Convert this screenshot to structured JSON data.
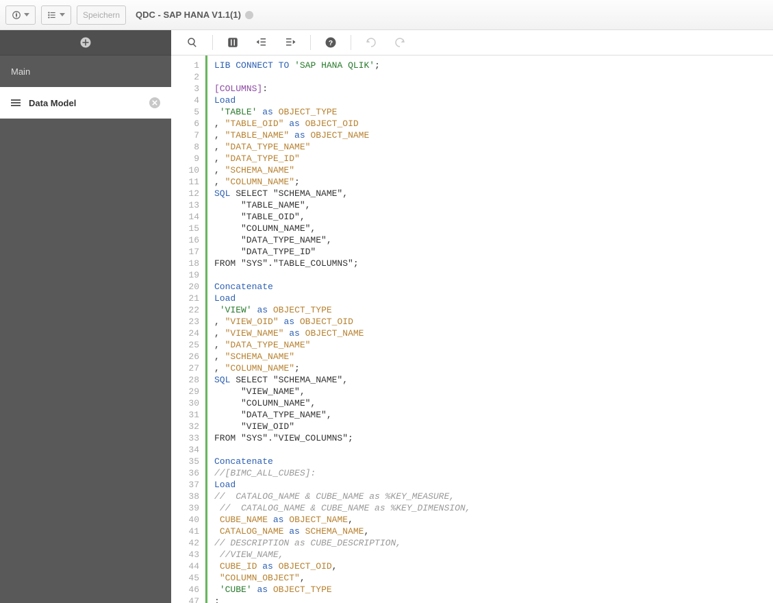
{
  "header": {
    "save_label": "Speichern",
    "title": "QDC - SAP HANA V1.1(1)"
  },
  "sidebar": {
    "items": [
      {
        "label": "Main"
      },
      {
        "label": "Data Model"
      }
    ]
  },
  "code": [
    [
      {
        "c": "t-kw",
        "t": "LIB"
      },
      {
        "c": "t-txt",
        "t": " "
      },
      {
        "c": "t-kw",
        "t": "CONNECT"
      },
      {
        "c": "t-txt",
        "t": " "
      },
      {
        "c": "t-kw",
        "t": "TO"
      },
      {
        "c": "t-txt",
        "t": " "
      },
      {
        "c": "t-str",
        "t": "'SAP HANA QLIK'"
      },
      {
        "c": "t-txt",
        "t": ";"
      }
    ],
    [],
    [
      {
        "c": "t-sec",
        "t": "[COLUMNS]"
      },
      {
        "c": "t-txt",
        "t": ":"
      }
    ],
    [
      {
        "c": "t-kw",
        "t": "Load"
      }
    ],
    [
      {
        "c": "t-txt",
        "t": " "
      },
      {
        "c": "t-str",
        "t": "'TABLE'"
      },
      {
        "c": "t-txt",
        "t": " "
      },
      {
        "c": "t-kw",
        "t": "as"
      },
      {
        "c": "t-txt",
        "t": " "
      },
      {
        "c": "t-id",
        "t": "OBJECT_TYPE"
      }
    ],
    [
      {
        "c": "t-txt",
        "t": ", "
      },
      {
        "c": "t-id",
        "t": "\"TABLE_OID\""
      },
      {
        "c": "t-txt",
        "t": " "
      },
      {
        "c": "t-kw",
        "t": "as"
      },
      {
        "c": "t-txt",
        "t": " "
      },
      {
        "c": "t-id",
        "t": "OBJECT_OID"
      }
    ],
    [
      {
        "c": "t-txt",
        "t": ", "
      },
      {
        "c": "t-id",
        "t": "\"TABLE_NAME\""
      },
      {
        "c": "t-txt",
        "t": " "
      },
      {
        "c": "t-kw",
        "t": "as"
      },
      {
        "c": "t-txt",
        "t": " "
      },
      {
        "c": "t-id",
        "t": "OBJECT_NAME"
      }
    ],
    [
      {
        "c": "t-txt",
        "t": ", "
      },
      {
        "c": "t-id",
        "t": "\"DATA_TYPE_NAME\""
      }
    ],
    [
      {
        "c": "t-txt",
        "t": ", "
      },
      {
        "c": "t-id",
        "t": "\"DATA_TYPE_ID\""
      }
    ],
    [
      {
        "c": "t-txt",
        "t": ", "
      },
      {
        "c": "t-id",
        "t": "\"SCHEMA_NAME\""
      }
    ],
    [
      {
        "c": "t-txt",
        "t": ", "
      },
      {
        "c": "t-id",
        "t": "\"COLUMN_NAME\""
      },
      {
        "c": "t-txt",
        "t": ";"
      }
    ],
    [
      {
        "c": "t-kw",
        "t": "SQL"
      },
      {
        "c": "t-txt",
        "t": " SELECT \"SCHEMA_NAME\","
      }
    ],
    [
      {
        "c": "t-txt",
        "t": "     \"TABLE_NAME\","
      }
    ],
    [
      {
        "c": "t-txt",
        "t": "     \"TABLE_OID\","
      }
    ],
    [
      {
        "c": "t-txt",
        "t": "     \"COLUMN_NAME\","
      }
    ],
    [
      {
        "c": "t-txt",
        "t": "     \"DATA_TYPE_NAME\","
      }
    ],
    [
      {
        "c": "t-txt",
        "t": "     \"DATA_TYPE_ID\""
      }
    ],
    [
      {
        "c": "t-txt",
        "t": "FROM \"SYS\".\"TABLE_COLUMNS\";"
      }
    ],
    [],
    [
      {
        "c": "t-kw",
        "t": "Concatenate"
      }
    ],
    [
      {
        "c": "t-kw",
        "t": "Load"
      }
    ],
    [
      {
        "c": "t-txt",
        "t": " "
      },
      {
        "c": "t-str",
        "t": "'VIEW'"
      },
      {
        "c": "t-txt",
        "t": " "
      },
      {
        "c": "t-kw",
        "t": "as"
      },
      {
        "c": "t-txt",
        "t": " "
      },
      {
        "c": "t-id",
        "t": "OBJECT_TYPE"
      }
    ],
    [
      {
        "c": "t-txt",
        "t": ", "
      },
      {
        "c": "t-id",
        "t": "\"VIEW_OID\""
      },
      {
        "c": "t-txt",
        "t": " "
      },
      {
        "c": "t-kw",
        "t": "as"
      },
      {
        "c": "t-txt",
        "t": " "
      },
      {
        "c": "t-id",
        "t": "OBJECT_OID"
      }
    ],
    [
      {
        "c": "t-txt",
        "t": ", "
      },
      {
        "c": "t-id",
        "t": "\"VIEW_NAME\""
      },
      {
        "c": "t-txt",
        "t": " "
      },
      {
        "c": "t-kw",
        "t": "as"
      },
      {
        "c": "t-txt",
        "t": " "
      },
      {
        "c": "t-id",
        "t": "OBJECT_NAME"
      }
    ],
    [
      {
        "c": "t-txt",
        "t": ", "
      },
      {
        "c": "t-id",
        "t": "\"DATA_TYPE_NAME\""
      }
    ],
    [
      {
        "c": "t-txt",
        "t": ", "
      },
      {
        "c": "t-id",
        "t": "\"SCHEMA_NAME\""
      }
    ],
    [
      {
        "c": "t-txt",
        "t": ", "
      },
      {
        "c": "t-id",
        "t": "\"COLUMN_NAME\""
      },
      {
        "c": "t-txt",
        "t": ";"
      }
    ],
    [
      {
        "c": "t-kw",
        "t": "SQL"
      },
      {
        "c": "t-txt",
        "t": " SELECT \"SCHEMA_NAME\","
      }
    ],
    [
      {
        "c": "t-txt",
        "t": "     \"VIEW_NAME\","
      }
    ],
    [
      {
        "c": "t-txt",
        "t": "     \"COLUMN_NAME\","
      }
    ],
    [
      {
        "c": "t-txt",
        "t": "     \"DATA_TYPE_NAME\","
      }
    ],
    [
      {
        "c": "t-txt",
        "t": "     \"VIEW_OID\""
      }
    ],
    [
      {
        "c": "t-txt",
        "t": "FROM \"SYS\".\"VIEW_COLUMNS\";"
      }
    ],
    [],
    [
      {
        "c": "t-kw",
        "t": "Concatenate"
      }
    ],
    [
      {
        "c": "t-cmt",
        "t": "//[BIMC_ALL_CUBES]:"
      }
    ],
    [
      {
        "c": "t-kw",
        "t": "Load"
      }
    ],
    [
      {
        "c": "t-cmt",
        "t": "//  CATALOG_NAME & CUBE_NAME as %KEY_MEASURE,"
      }
    ],
    [
      {
        "c": "t-txt",
        "t": " "
      },
      {
        "c": "t-cmt",
        "t": "//  CATALOG_NAME & CUBE_NAME as %KEY_DIMENSION,"
      }
    ],
    [
      {
        "c": "t-txt",
        "t": " "
      },
      {
        "c": "t-id",
        "t": "CUBE_NAME"
      },
      {
        "c": "t-txt",
        "t": " "
      },
      {
        "c": "t-kw",
        "t": "as"
      },
      {
        "c": "t-txt",
        "t": " "
      },
      {
        "c": "t-id",
        "t": "OBJECT_NAME"
      },
      {
        "c": "t-txt",
        "t": ","
      }
    ],
    [
      {
        "c": "t-txt",
        "t": " "
      },
      {
        "c": "t-id",
        "t": "CATALOG_NAME"
      },
      {
        "c": "t-txt",
        "t": " "
      },
      {
        "c": "t-kw",
        "t": "as"
      },
      {
        "c": "t-txt",
        "t": " "
      },
      {
        "c": "t-id",
        "t": "SCHEMA_NAME"
      },
      {
        "c": "t-txt",
        "t": ","
      }
    ],
    [
      {
        "c": "t-cmt",
        "t": "// DESCRIPTION as CUBE_DESCRIPTION,"
      }
    ],
    [
      {
        "c": "t-txt",
        "t": " "
      },
      {
        "c": "t-cmt",
        "t": "//VIEW_NAME,"
      }
    ],
    [
      {
        "c": "t-txt",
        "t": " "
      },
      {
        "c": "t-id",
        "t": "CUBE_ID"
      },
      {
        "c": "t-txt",
        "t": " "
      },
      {
        "c": "t-kw",
        "t": "as"
      },
      {
        "c": "t-txt",
        "t": " "
      },
      {
        "c": "t-id",
        "t": "OBJECT_OID"
      },
      {
        "c": "t-txt",
        "t": ","
      }
    ],
    [
      {
        "c": "t-txt",
        "t": " "
      },
      {
        "c": "t-id",
        "t": "\"COLUMN_OBJECT\""
      },
      {
        "c": "t-txt",
        "t": ","
      }
    ],
    [
      {
        "c": "t-txt",
        "t": " "
      },
      {
        "c": "t-str",
        "t": "'CUBE'"
      },
      {
        "c": "t-txt",
        "t": " "
      },
      {
        "c": "t-kw",
        "t": "as"
      },
      {
        "c": "t-txt",
        "t": " "
      },
      {
        "c": "t-id",
        "t": "OBJECT_TYPE"
      }
    ],
    [
      {
        "c": "t-txt",
        "t": ";"
      }
    ]
  ]
}
